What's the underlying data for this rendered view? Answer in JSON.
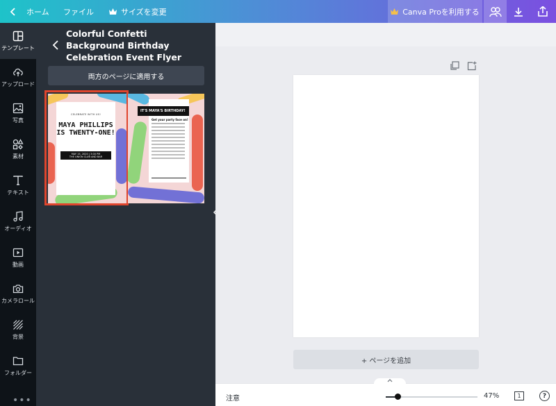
{
  "topbar": {
    "home_label": "ホーム",
    "file_label": "ファイル",
    "resize_label": "サイズを変更",
    "pro_label": "Canva Proを利用する"
  },
  "rail": {
    "items": [
      {
        "label": "テンプレート",
        "icon": "template-icon"
      },
      {
        "label": "アップロード",
        "icon": "upload-icon"
      },
      {
        "label": "写真",
        "icon": "photo-icon"
      },
      {
        "label": "素材",
        "icon": "elements-icon"
      },
      {
        "label": "テキスト",
        "icon": "text-icon"
      },
      {
        "label": "オーディオ",
        "icon": "music-icon"
      },
      {
        "label": "動画",
        "icon": "video-icon"
      },
      {
        "label": "カメラロール",
        "icon": "camera-icon"
      },
      {
        "label": "背景",
        "icon": "background-icon"
      },
      {
        "label": "フォルダー",
        "icon": "folder-icon"
      }
    ],
    "more": "•••"
  },
  "panel": {
    "title": "Colorful Confetti Background Birthday Celebration Event Flyer",
    "apply_button": "両方のページに適用する"
  },
  "thumb1": {
    "kicker": "CELEBRATE WITH US!",
    "headline1": "MAYA PHILLIPS",
    "headline2": "IS TWENTY-ONE!",
    "date": "MAY 15, 2020 | 3:00 PM",
    "venue": "THE UNION CLUB AND BAR"
  },
  "thumb2": {
    "banner": "IT'S MAYA'S BIRTHDAY!",
    "heading": "Get your party face on!"
  },
  "canvas": {
    "add_page": "+ ページを追加"
  },
  "bottombar": {
    "notes": "注意",
    "zoom": "47%",
    "zoom_value": 0.47,
    "page_count": "1",
    "help": "?"
  },
  "colors": {
    "selection": "#e0452d",
    "sidebar": "#0e1318",
    "panel": "#293039"
  }
}
